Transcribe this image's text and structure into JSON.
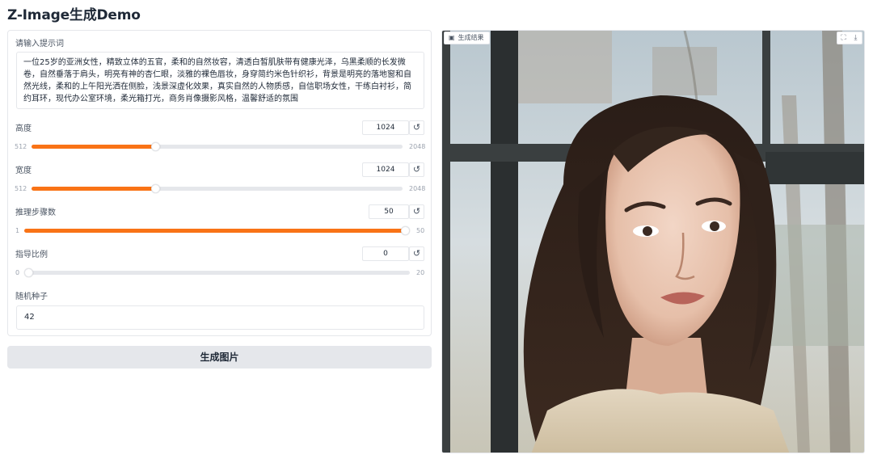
{
  "app": {
    "title": "Z-Image生成Demo"
  },
  "prompt": {
    "label": "请输入提示词",
    "value": "一位25岁的亚洲女性，精致立体的五官，柔和的自然妆容，清透白皙肌肤带有健康光泽，乌黑柔顺的长发微卷，自然垂落于肩头，明亮有神的杏仁眼，淡雅的裸色唇妆，身穿简约米色针织衫，背景是明亮的落地窗和自然光线，柔和的上午阳光洒在侧脸，浅景深虚化效果，真实自然的人物质感，自信职场女性，干练白衬衫，简约耳环，现代办公室环境，柔光箱打光，商务肖像摄影风格，温馨舒适的氛围"
  },
  "height": {
    "label": "高度",
    "value": "1024",
    "min": "512",
    "max": "2048",
    "fraction": 0.333
  },
  "width": {
    "label": "宽度",
    "value": "1024",
    "min": "512",
    "max": "2048",
    "fraction": 0.333
  },
  "steps": {
    "label": "推理步骤数",
    "value": "50",
    "min": "1",
    "max": "50",
    "fraction": 1.0
  },
  "guidance": {
    "label": "指导比例",
    "value": "0",
    "min": "0",
    "max": "20",
    "fraction": 0.0
  },
  "seed": {
    "label": "随机种子",
    "value": "42"
  },
  "generate_button": "生成图片",
  "result": {
    "label": "生成结果",
    "image_icon": "image-icon",
    "fullscreen_icon": "fullscreen-icon",
    "download_icon": "download-icon"
  },
  "colors": {
    "accent": "#f97316",
    "track": "#e5e7eb",
    "button_bg": "#e5e7eb"
  },
  "icons": {
    "reset": "reset-icon"
  }
}
